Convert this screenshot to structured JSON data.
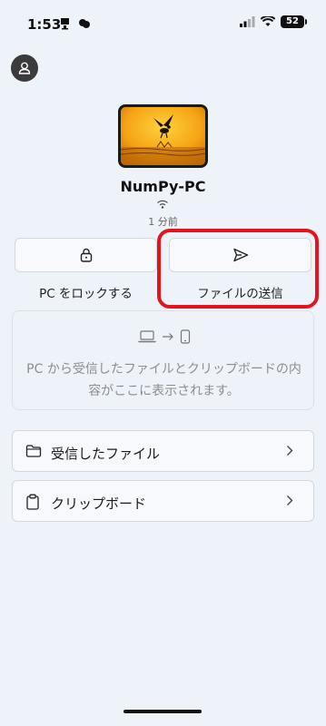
{
  "status_bar": {
    "time": "1:53",
    "battery": "52"
  },
  "device": {
    "name": "NumPy-PC",
    "last_seen": "1 分前"
  },
  "actions": [
    {
      "label": "PC をロックする",
      "icon": "lock-icon"
    },
    {
      "label": "ファイルの送信",
      "icon": "send-icon"
    }
  ],
  "info": {
    "text": "PC から受信したファイルとクリップボードの内容がここに表示されます。"
  },
  "menu": [
    {
      "label": "受信したファイル",
      "icon": "folder-icon"
    },
    {
      "label": "クリップボード",
      "icon": "clipboard-icon"
    }
  ],
  "colors": {
    "highlight": "#e5141b",
    "background": "#eef2f9"
  }
}
